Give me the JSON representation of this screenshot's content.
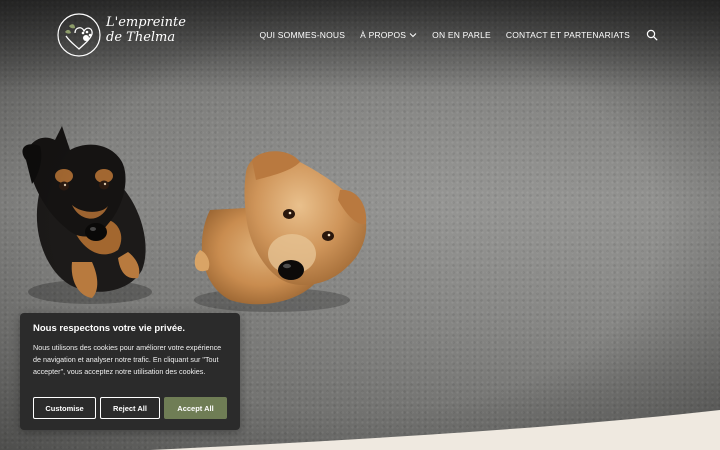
{
  "brand": {
    "logo_line1": "L'empreinte",
    "logo_line2": "de Thelma"
  },
  "nav": {
    "items": [
      {
        "label": "QUI SOMMES-NOUS"
      },
      {
        "label": "À PROPOS",
        "has_dropdown": true
      },
      {
        "label": "ON EN PARLE"
      },
      {
        "label": "CONTACT ET PARTENARIATS"
      }
    ],
    "search_icon": "search-icon"
  },
  "cookie": {
    "title": "Nous respectons votre vie privée.",
    "text": "Nous utilisons des cookies pour améliorer votre expérience de navigation et analyser notre trafic. En cliquant sur \"Tout accepter\", vous acceptez notre utilisation des cookies.",
    "customise_label": "Customise",
    "reject_label": "Reject All",
    "accept_label": "Accept All"
  },
  "colors": {
    "accent_green": "#6f7d55",
    "banner_bg": "#2b2b2b",
    "footer_beige": "#efe9e0"
  }
}
